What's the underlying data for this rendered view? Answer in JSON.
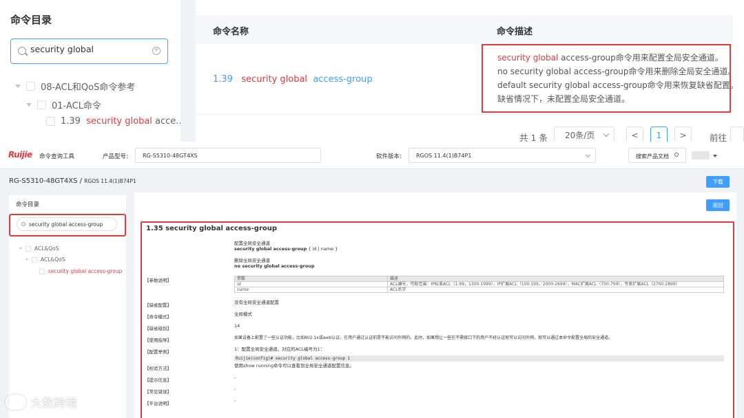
{
  "top": {
    "dir_title": "命令目录",
    "search_value": "security global",
    "tree": {
      "l1": "08-ACL和QoS命令参考",
      "l2": "01-ACL命令",
      "l3_num": "1.39",
      "l3_red": "security global",
      "l3_rest": "acce..."
    },
    "table": {
      "col_name": "命令名称",
      "col_desc": "命令描述",
      "row_num": "1.39",
      "row_red": "security global",
      "row_rest": "access-group",
      "desc": {
        "line1_red": "security global",
        "line1_rest": "access-group命令用来配置全局安全通道。",
        "line2": "no security global access-group命令用来删除全局安全通道。",
        "line3": "default security global access-group命令用来恢复缺省配置。",
        "line4": "缺省情况下，未配置全局安全通道。"
      }
    },
    "pager": {
      "total": "共 1 条",
      "size": "20条/页",
      "prev": "<",
      "page": "1",
      "next": ">",
      "goto": "前往"
    }
  },
  "bottom": {
    "nav": {
      "logo": "Ruijie",
      "tool_name": "命令查询工具",
      "model_label": "产品型号:",
      "model_value": "RG-S5310-48GT4XS",
      "version_label": "软件版本:",
      "version_value": "RGOS 11.4(1)B74P1",
      "search_docs": "搜索产品文档"
    },
    "breadcrumb_main": "RG-S5310-48GT4XS /",
    "breadcrumb_sub": "RGOS 11.4(1)B74P1",
    "download": "下载",
    "back": "返回",
    "sidebar": {
      "title": "命令目录",
      "search_value": "security global access-group",
      "tree_l1": "ACL&QoS",
      "tree_l2": "ACL&QoS",
      "tree_l3": "security global access-group"
    },
    "doc": {
      "title": "1.35 security global access-group",
      "syntax_desc1": "配置全局安全通道",
      "syntax_cmd1": "security global access-group",
      "syntax_args1": "{ id | name }",
      "syntax_desc2": "删除全局安全通道",
      "syntax_cmd2": "no security global access-group",
      "label_params": "【参数说明】",
      "param_header": [
        "参数",
        "描述"
      ],
      "param_rows": [
        [
          "id",
          "ACL编号，可配范围：IP标准ACL（1-99，1300-1999），IP扩展ACL（100-199，2000-2699），MAC扩展ACL（700-799），专家扩展ACL（2700-2899）"
        ],
        [
          "name",
          "ACL名字"
        ]
      ],
      "label_default": "【缺省配置】",
      "value_default": "没有全局安全通道配置",
      "label_mode": "【命令模式】",
      "value_mode": "全局模式",
      "label_level": "【缺省级别】",
      "value_level": "14",
      "label_guide": "【使用指导】",
      "value_guide": "如果设备上配置了一些认证功能，比如802.1x或web认证，在用户通过认证前是不能访问外网的。此时，如果想让一些在不需接口下的用户不经认证就可以访问外网，就可以通过本命令配置全局的安全通道。",
      "label_example": "【配置举例】",
      "value_example": "1：配置全局安全通道，对应的ACL编号为1：",
      "example_code": "Ruijie(config)# security global access-group 1",
      "label_verify": "【检验方法】",
      "value_verify": "使用show running命令可以查看到全局安全通道配置信息。",
      "label_prompt": "【提示信息】",
      "value_prompt": "-",
      "label_errors": "【常见错误】",
      "value_errors": "-",
      "label_platform": "【平台说明】",
      "value_platform": "-"
    },
    "watermark": "大数跨境"
  }
}
